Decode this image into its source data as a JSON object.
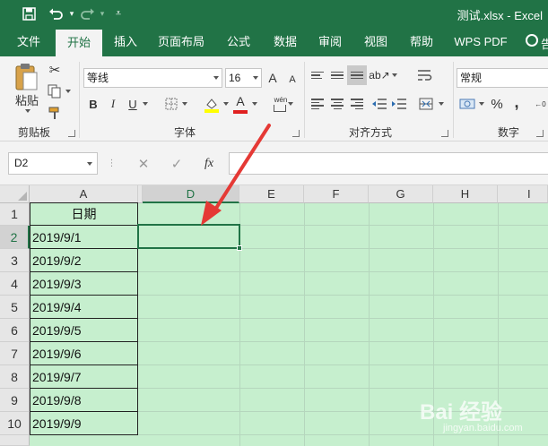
{
  "titlebar": {
    "quick_access": [
      "save-icon",
      "undo-icon",
      "redo-icon",
      "customize-icon"
    ],
    "doc_title": "测试.xlsx  -  Excel",
    "bg_color": "#217346"
  },
  "tabs": [
    {
      "label": "文件",
      "active": false
    },
    {
      "label": "开始",
      "active": true
    },
    {
      "label": "插入",
      "active": false
    },
    {
      "label": "页面布局",
      "active": false
    },
    {
      "label": "公式",
      "active": false
    },
    {
      "label": "数据",
      "active": false
    },
    {
      "label": "审阅",
      "active": false
    },
    {
      "label": "视图",
      "active": false
    },
    {
      "label": "帮助",
      "active": false
    },
    {
      "label": "WPS PDF",
      "active": false
    }
  ],
  "tell_me": {
    "label": "告"
  },
  "ribbon": {
    "clipboard": {
      "paste_label": "粘贴",
      "group_label": "剪贴板"
    },
    "font": {
      "font_name": "等线",
      "font_size": "16",
      "bold": "B",
      "italic": "I",
      "underline": "U",
      "grow": "A",
      "shrink": "A",
      "font_color_letter": "A",
      "phonetic": "wén",
      "group_label": "字体"
    },
    "alignment": {
      "group_label": "对齐方式"
    },
    "number": {
      "format": "常规",
      "percent": "%",
      "comma": ",",
      "group_label": "数字"
    }
  },
  "formula_bar": {
    "name_box": "D2",
    "cancel": "✕",
    "enter": "✓",
    "fx": "fx",
    "value": ""
  },
  "grid": {
    "columns": [
      "A",
      "D",
      "E",
      "F",
      "G",
      "H",
      "I"
    ],
    "selected_column": "D",
    "rows": [
      "1",
      "2",
      "3",
      "4",
      "5",
      "6",
      "7",
      "8",
      "9",
      "10"
    ],
    "selected_row": "2",
    "column_a": [
      "日期",
      "2019/9/1",
      "2019/9/2",
      "2019/9/3",
      "2019/9/4",
      "2019/9/5",
      "2019/9/6",
      "2019/9/7",
      "2019/9/8",
      "2019/9/9"
    ],
    "selected_cell": "D2",
    "sheet_bg": "#c6efce",
    "annotation_arrow_color": "#e53935"
  },
  "watermark": {
    "logo": "Bai 经验",
    "url": "jingyan.baidu.com"
  }
}
